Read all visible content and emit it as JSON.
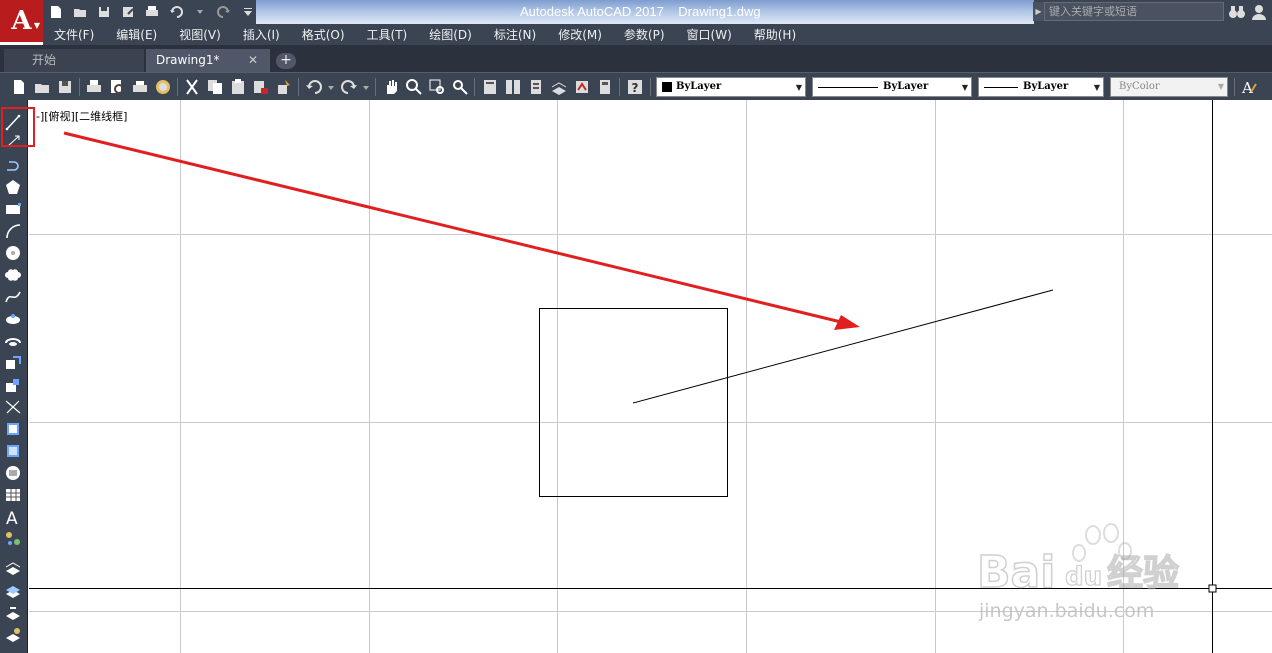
{
  "title_bar": {
    "app_logo": "A",
    "title": "Autodesk AutoCAD 2017    Drawing1.dwg",
    "search_placeholder": "键入关键字或短语"
  },
  "menu": [
    "文件(F)",
    "编辑(E)",
    "视图(V)",
    "插入(I)",
    "格式(O)",
    "工具(T)",
    "绘图(D)",
    "标注(N)",
    "修改(M)",
    "参数(P)",
    "窗口(W)",
    "帮助(H)"
  ],
  "tabs": {
    "start": "开始",
    "drawing": "Drawing1*",
    "close": "✕",
    "add": "+"
  },
  "properties": {
    "color": "ByLayer",
    "linetype": "ByLayer",
    "lineweight": "ByLayer",
    "plot_style": "ByColor"
  },
  "viewport_label": "-][俯视][二维线框]",
  "watermark": {
    "brand": "Bai",
    "brand_du": "du",
    "brand_cn": "经验",
    "url": "jingyan.baidu.com"
  },
  "colors": {
    "chrome": "#3b4453",
    "accent_red": "#e02020",
    "logo_red": "#b91c1c"
  }
}
